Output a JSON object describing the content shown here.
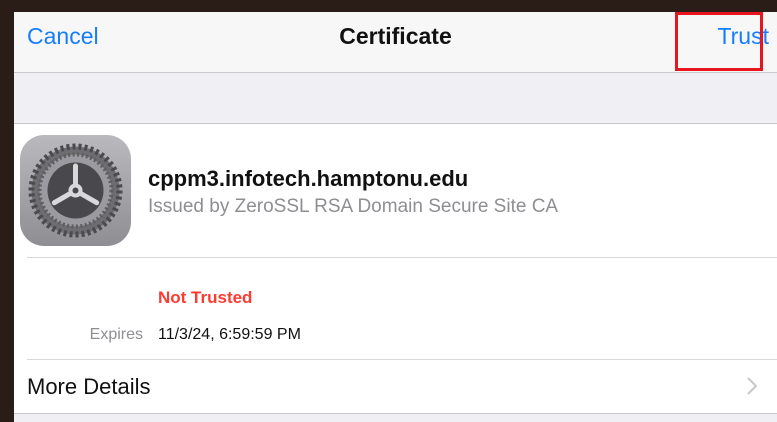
{
  "navbar": {
    "cancel_label": "Cancel",
    "title": "Certificate",
    "trust_label": "Trust"
  },
  "certificate": {
    "icon": "gear-icon",
    "name": "cppm3.infotech.hamptonu.edu",
    "issuer": "Issued by ZeroSSL RSA Domain Secure Site CA",
    "status": "Not Trusted",
    "expires_label": "Expires",
    "expires_value": "11/3/24, 6:59:59 PM"
  },
  "more_details": {
    "label": "More Details",
    "icon": "chevron-right-icon"
  },
  "colors": {
    "accent": "#157efb",
    "warning": "#ff3b30",
    "highlight": "#e8141e"
  }
}
